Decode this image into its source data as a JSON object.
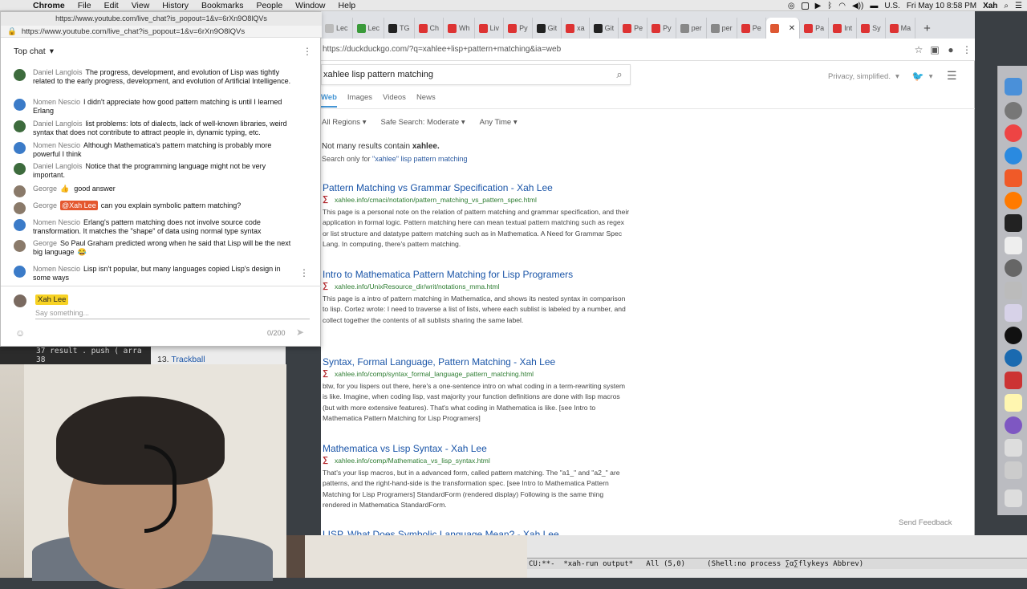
{
  "menubar": {
    "app": "Chrome",
    "items": [
      "File",
      "Edit",
      "View",
      "History",
      "Bookmarks",
      "People",
      "Window",
      "Help"
    ],
    "locale": "U.S.",
    "datetime": "Fri May 10  8:58 PM",
    "user": "Xah"
  },
  "chat_window": {
    "title": "https://www.youtube.com/live_chat?is_popout=1&v=6rXn9O8lQVs",
    "url": "https://www.youtube.com/live_chat?is_popout=1&v=6rXn9O8lQVs",
    "header_label": "Top chat",
    "messages": [
      {
        "author": "Daniel Langlois",
        "text": "The progress, development, and evolution of Lisp was tightly related to the early progress, development, and evolution of Artificial Intelligence."
      },
      {
        "author": "Nomen Nescio",
        "text": "I didn't appreciate how good pattern matching is until I learned Erlang"
      },
      {
        "author": "Daniel Langlois",
        "text": "list problems: lots of dialects, lack of well-known libraries, weird syntax that does not contribute to attract people in, dynamic typing, etc."
      },
      {
        "author": "Nomen Nescio",
        "text": "Although Mathematica's pattern matching is probably more powerful I think"
      },
      {
        "author": "Daniel Langlois",
        "text": "Notice that the programming language might not be very important."
      },
      {
        "author": "George",
        "emoji": "👍",
        "text": "good answer"
      },
      {
        "author": "George",
        "mention": "@Xah Lee",
        "text": "can you explain symbolic pattern matching?"
      },
      {
        "author": "Nomen Nescio",
        "text": "Erlang's pattern matching does not involve source code transformation. It matches the \"shape\" of data using normal type syntax"
      },
      {
        "author": "George",
        "text": "So Paul Graham predicted wrong when he said that Lisp will be the next big language",
        "emoji": "😂"
      },
      {
        "author": "Nomen Nescio",
        "text": "Lisp isn't popular, but many languages copied Lisp's design in some ways"
      }
    ],
    "composer": {
      "user": "Xah Lee",
      "placeholder": "Say something...",
      "counter": "0/200"
    }
  },
  "code_snippet": {
    "line1": "37    result . push ( arra",
    "line2": "38"
  },
  "trackball_item": {
    "number": "13.",
    "label": "Trackball"
  },
  "browser": {
    "tabs": [
      {
        "label": "Lec",
        "color": "#bbb"
      },
      {
        "label": "Lec",
        "color": "#3a9a3a"
      },
      {
        "label": "TG",
        "color": "#222"
      },
      {
        "label": "Ch",
        "color": "#d33"
      },
      {
        "label": "Wh",
        "color": "#d33"
      },
      {
        "label": "Liv",
        "color": "#d33"
      },
      {
        "label": "Py",
        "color": "#d33"
      },
      {
        "label": "Git",
        "color": "#222"
      },
      {
        "label": "xa",
        "color": "#d33"
      },
      {
        "label": "Git",
        "color": "#222"
      },
      {
        "label": "Pe",
        "color": "#d33"
      },
      {
        "label": "Py",
        "color": "#d33"
      },
      {
        "label": "per",
        "color": "#888"
      },
      {
        "label": "per",
        "color": "#888"
      },
      {
        "label": "Pe",
        "color": "#d33"
      }
    ],
    "active_tab": {
      "label": "",
      "color": "#de5833"
    },
    "tabs_after": [
      {
        "label": "Pa",
        "color": "#d33"
      },
      {
        "label": "Int",
        "color": "#d33"
      },
      {
        "label": "Sy",
        "color": "#d33"
      },
      {
        "label": "Ma",
        "color": "#d33"
      }
    ],
    "address": "https://duckduckgo.com/?q=xahlee+lisp+pattern+matching&ia=web"
  },
  "ddg": {
    "query": "xahlee lisp pattern matching",
    "privacy": "Privacy, simplified.",
    "nav": [
      "Web",
      "Images",
      "Videos",
      "News"
    ],
    "filters": [
      "All Regions",
      "Safe Search: Moderate",
      "Any Time"
    ],
    "notice_prefix": "Not many results contain ",
    "notice_term": "xahlee.",
    "search_only_prefix": "Search only for ",
    "search_only_link": "\"xahlee\" lisp pattern matching",
    "results": [
      {
        "title": "Pattern Matching vs Grammar Specification - Xah Lee",
        "url": "xahlee.info/cmaci/notation/pattern_matching_vs_pattern_spec.html",
        "snippet": "This page is a personal note on the relation of pattern matching and grammar specification, and their application in formal logic. Pattern matching here can mean textual pattern matching such as regex or list structure and datatype pattern matching such as in Mathematica. A Need for Grammar Spec Lang. In computing, there's pattern matching."
      },
      {
        "title": "Intro to Mathematica Pattern Matching for Lisp Programers",
        "url": "xahlee.info/UnixResource_dir/writ/notations_mma.html",
        "snippet": "This page is a intro of pattern matching in Mathematica, and shows its nested syntax in comparison to lisp. Cortez wrote: I need to traverse a list of lists, where each sublist is labeled by a number, and collect together the contents of all sublists sharing the same label."
      },
      {
        "title": "Syntax, Formal Language, Pattern Matching - Xah Lee",
        "url": "xahlee.info/comp/syntax_formal_language_pattern_matching.html",
        "snippet": "btw, for you lispers out there, here's a one-sentence intro on what coding in a term-rewriting system is like. Imagine, when coding lisp, vast majority your function definitions are done with lisp macros (but with more extensive features). That's what coding in Mathematica is like. [see Intro to Mathematica Pattern Matching for Lisp Programers]"
      },
      {
        "title": "Mathematica vs Lisp Syntax - Xah Lee",
        "url": "xahlee.info/comp/Mathematica_vs_lisp_syntax.html",
        "snippet": "That's your lisp macros, but in a advanced form, called pattern matching. The \"a1_\" and \"a2_\" are patterns, and the right-hand-side is the transformation spec. [see Intro to Mathematica Pattern Matching for Lisp Programers] StandardForm (rendered display) Following is the same thing rendered in Mathematica StandardForm."
      },
      {
        "title": "LISP, What Does Symbolic Language Mean? - Xah Lee",
        "url": "",
        "snippet": ""
      }
    ],
    "feedback": "Send Feedback"
  },
  "emacs": {
    "modeline": "CU:**-  *xah-run output*   All (5,0)     (Shell:no process ∑α∑flykeys Abbrev)"
  }
}
